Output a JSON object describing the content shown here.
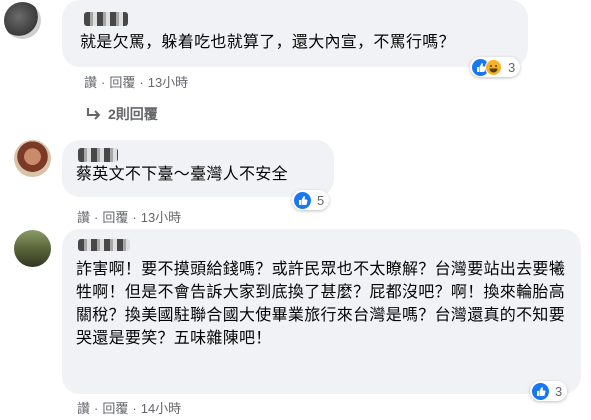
{
  "comments": [
    {
      "text": "就是欠罵，躲着吃也就算了，還大內宣，不罵行嗎？",
      "actions": {
        "like": "讚",
        "reply": "回覆",
        "time": "13小時"
      },
      "reaction_count": "3",
      "reactions": [
        "like-icon",
        "haha-icon"
      ]
    },
    {
      "text": "蔡英文不下臺～臺灣人不安全",
      "actions": {
        "like": "讚",
        "reply": "回覆",
        "time": "13小時"
      },
      "reaction_count": "5",
      "reactions": [
        "like-icon"
      ]
    },
    {
      "text": "詐害啊！要不摸頭給錢嗎？或許民眾也不太瞭解？台灣要站出去要犧牲啊！但是不會告訴大家到底換了甚麼？屁都沒吧？啊！換來輪胎高關稅？換美國駐聯合國大使畢業旅行來台灣是嗎？台灣還真的不知要哭還是要笑？五味雜陳吧！",
      "actions": {
        "like": "讚",
        "reply": "回覆",
        "time": "14小時"
      },
      "reaction_count": "3",
      "reactions": [
        "like-icon"
      ]
    }
  ],
  "replies_link": "2則回覆",
  "separator": "·",
  "colors": {
    "bubble": "#f0f2f5",
    "meta": "#65676b",
    "like": "#1877f2",
    "haha": "#f7b125"
  }
}
